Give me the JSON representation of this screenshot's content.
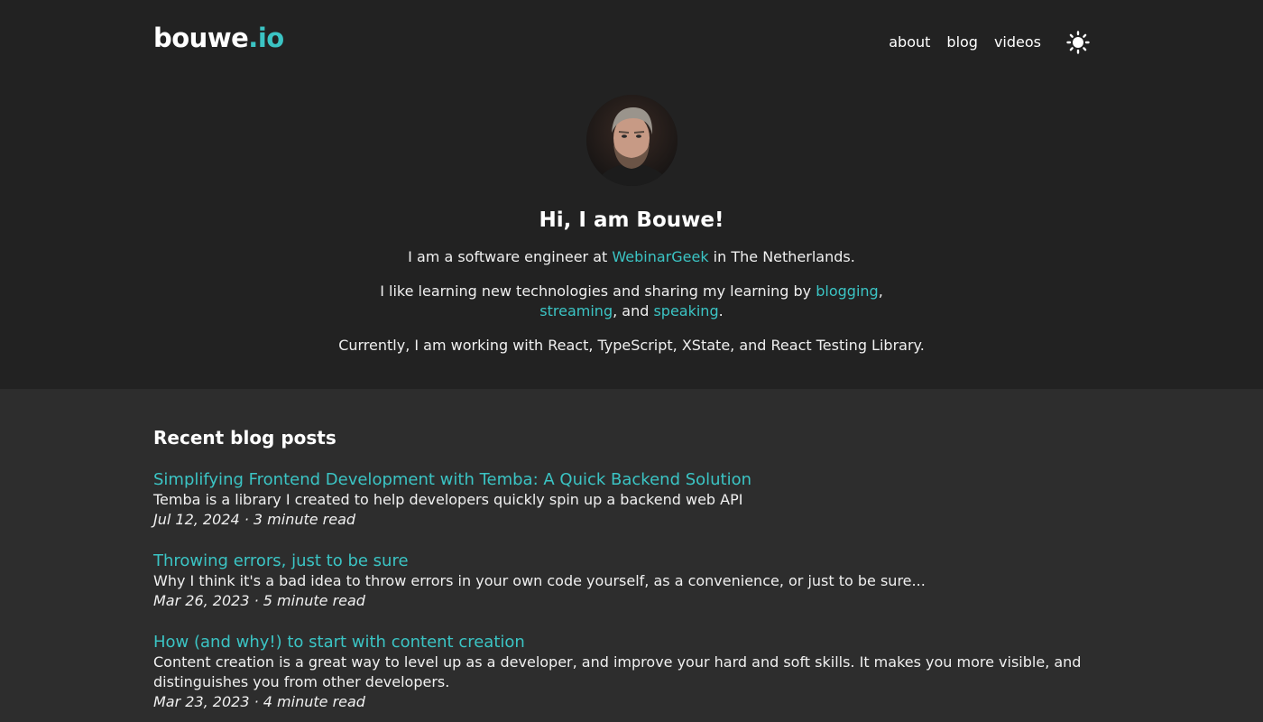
{
  "header": {
    "logo_main": "bouwe",
    "logo_accent": ".io",
    "nav": [
      "about",
      "blog",
      "videos"
    ],
    "theme_icon": "sun-icon"
  },
  "intro": {
    "heading": "Hi, I am Bouwe!",
    "line1_pre": "I am a software engineer at ",
    "line1_link": "WebinarGeek",
    "line1_post": " in The Netherlands.",
    "line2_pre": "I like learning new technologies and sharing my learning by ",
    "link_blogging": "blogging",
    "sep1": ", ",
    "link_streaming": "streaming",
    "sep2": ", and ",
    "link_speaking": "speaking",
    "end": ".",
    "line3": "Currently, I am working with React, TypeScript, XState, and React Testing Library."
  },
  "posts": {
    "heading": "Recent blog posts",
    "items": [
      {
        "title": "Simplifying Frontend Development with Temba: A Quick Backend Solution",
        "description": "Temba is a library I created to help developers quickly spin up a backend web API",
        "meta": "Jul 12, 2024 · 3 minute read"
      },
      {
        "title": "Throwing errors, just to be sure",
        "description": "Why I think it's a bad idea to throw errors in your own code yourself, as a convenience, or just to be sure...",
        "meta": "Mar 26, 2023 · 5 minute read"
      },
      {
        "title": "How (and why!) to start with content creation",
        "description": "Content creation is a great way to level up as a developer, and improve your hard and soft skills. It makes you more visible, and distinguishes you from other developers.",
        "meta": "Mar 23, 2023 · 4 minute read"
      }
    ]
  },
  "colors": {
    "accent": "#3bc4c4",
    "header_bg": "#222222",
    "content_bg": "#2d2d2d"
  }
}
